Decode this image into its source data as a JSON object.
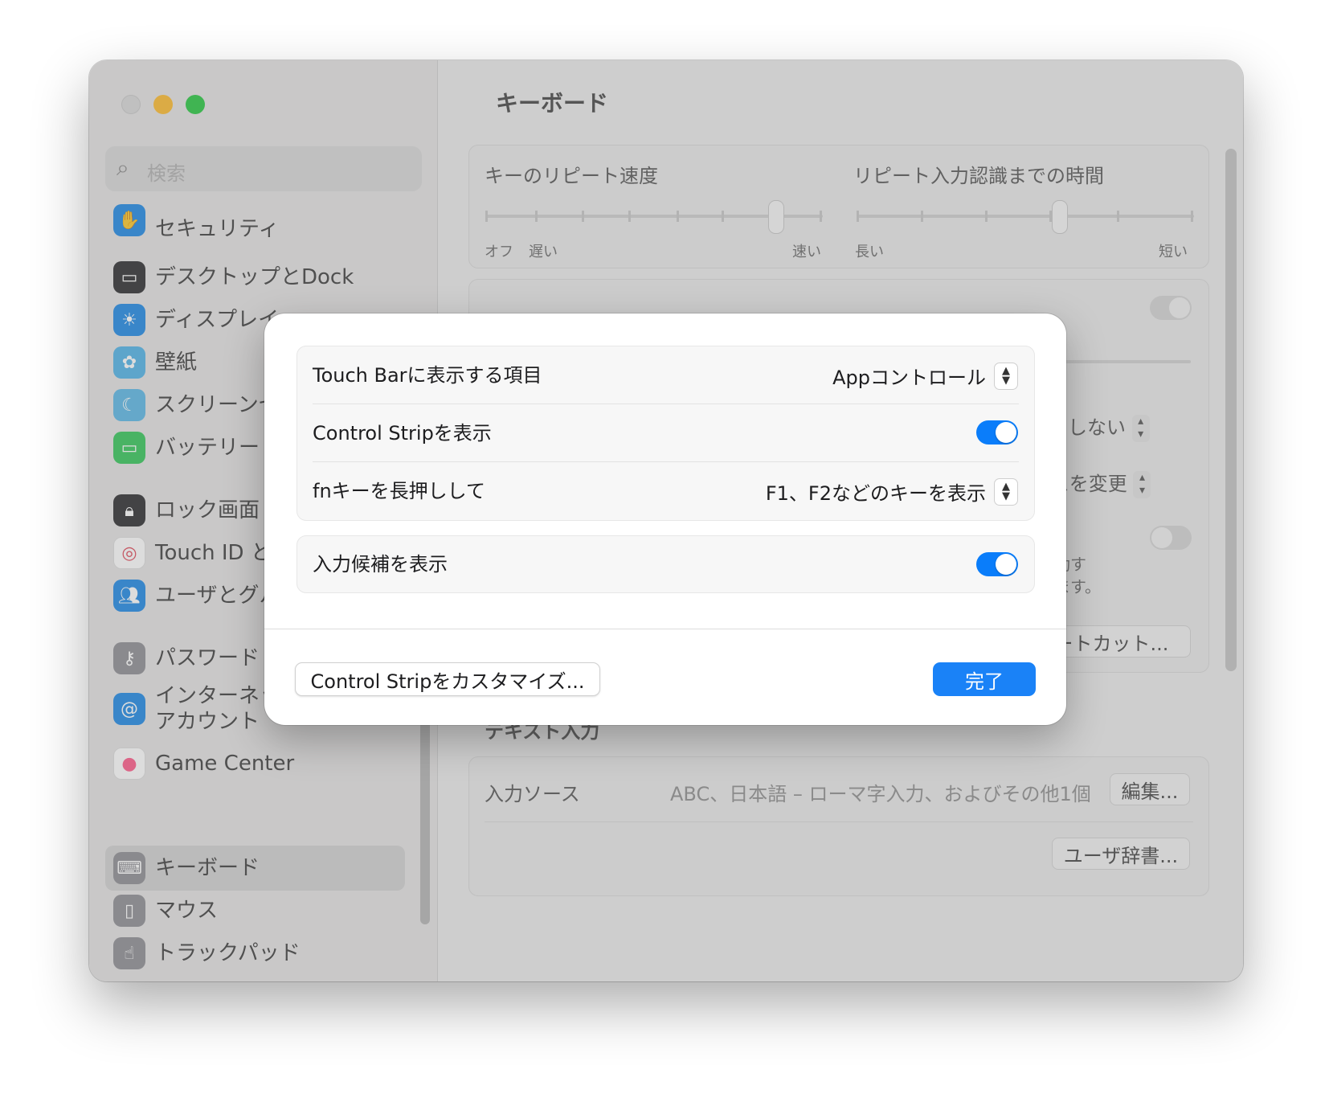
{
  "window": {
    "title": "キーボード",
    "search_placeholder": "検索"
  },
  "sidebar": {
    "partial_item": "セキュリティ",
    "items": [
      {
        "label": "デスクトップとDock",
        "icon": "dock-icon",
        "color": "#2c2c2e"
      },
      {
        "label": "ディスプレイ",
        "icon": "brightness-icon",
        "color": "#1e88e5"
      },
      {
        "label": "壁紙",
        "icon": "flower-icon",
        "color": "#4fb3e8"
      },
      {
        "label": "スクリーンセ",
        "icon": "screensaver-icon",
        "color": "#5ab8e6"
      },
      {
        "label": "バッテリー",
        "icon": "battery-icon",
        "color": "#34c759"
      },
      {
        "label": "ロック画面",
        "icon": "lock-icon",
        "color": "#2c2c2e"
      },
      {
        "label": "Touch ID と",
        "icon": "fingerprint-icon",
        "color": "#ffffff"
      },
      {
        "label": "ユーザとグル",
        "icon": "users-icon",
        "color": "#1e88e5"
      },
      {
        "label": "パスワード",
        "icon": "key-icon",
        "color": "#8e8e93"
      },
      {
        "label": "インターネット\nアカウント",
        "icon": "at-icon",
        "color": "#1e88e5"
      },
      {
        "label": "Game Center",
        "icon": "gamecenter-icon",
        "color": "#ffffff"
      },
      {
        "label": "キーボード",
        "icon": "keyboard-icon",
        "color": "#8e8e93"
      },
      {
        "label": "マウス",
        "icon": "mouse-icon",
        "color": "#8e8e93"
      },
      {
        "label": "トラックパッド",
        "icon": "trackpad-icon",
        "color": "#8e8e93"
      }
    ],
    "selected": "キーボード"
  },
  "main": {
    "repeat": {
      "key_repeat_label": "キーのリピート速度",
      "delay_label": "リピート入力認識までの時間",
      "key_repeat_min_labels": [
        "オフ",
        "遅い"
      ],
      "key_repeat_max_label": "速い",
      "delay_min_label": "長い",
      "delay_max_label": "短い",
      "key_repeat_level": 0.86,
      "delay_level": 0.6
    },
    "peek": {
      "no_label": "しない",
      "input_change_suffix": "ースを変更",
      "move_line1": "に移動す",
      "move_line2": "切します。",
      "shortcut_button": "ートカット..."
    },
    "text_input": {
      "heading": "テキスト入力",
      "input_sources_label": "入力ソース",
      "input_sources_value": "ABC、日本語 – ローマ字入力、およびその他1個",
      "edit_button": "編集...",
      "user_dict_button": "ユーザ辞書..."
    }
  },
  "sheet": {
    "rows": [
      {
        "label": "Touch Barに表示する項目",
        "value": "Appコントロール"
      },
      {
        "label": "Control Stripを表示",
        "toggle": true
      },
      {
        "label": "fnキーを長押しして",
        "value": "F1、F2などのキーを表示"
      }
    ],
    "suggestions": {
      "label": "入力候補を表示",
      "toggle": true
    },
    "customize_button": "Control Stripをカスタマイズ...",
    "done_button": "完了",
    "accent": "#0a7dfa"
  }
}
